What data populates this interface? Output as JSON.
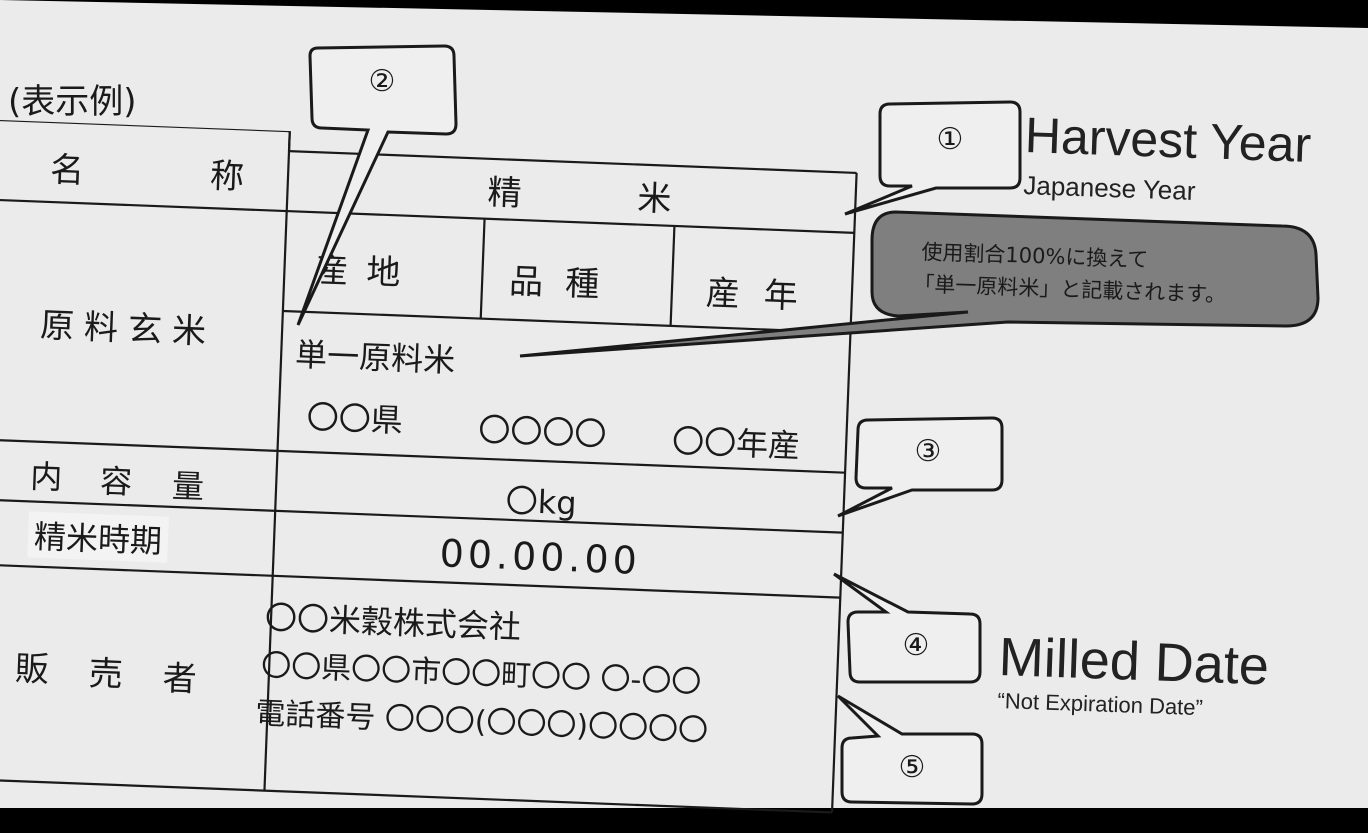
{
  "example_label": "(表示例)",
  "table": {
    "name_label": [
      "名",
      "称"
    ],
    "name_value": [
      "精",
      "米"
    ],
    "raw_label": "原料玄米",
    "sub_headers": [
      "産地",
      "品種",
      "産年"
    ],
    "single_origin": "単一原料米",
    "origin_row": [
      "〇〇県",
      "〇〇〇〇",
      "〇〇年産"
    ],
    "content_label": [
      "内",
      "容",
      "量"
    ],
    "content_value": "〇kg",
    "milled_label": "精米時期",
    "milled_value": "00.00.00",
    "seller_label": [
      "販",
      "売",
      "者"
    ],
    "seller_lines": [
      "〇〇米穀株式会社",
      "〇〇県〇〇市〇〇町〇〇 〇-〇〇",
      "電話番号 〇〇〇(〇〇〇)〇〇〇〇"
    ]
  },
  "callouts": {
    "c1": "①",
    "c2": "②",
    "c3": "③",
    "c4": "④",
    "c5": "⑤",
    "note_line1": "使用割合100%に換えて",
    "note_line2": "「単一原料米」と記載されます。"
  },
  "annotations": {
    "harvest_title": "Harvest Year",
    "harvest_sub": "Japanese Year",
    "milled_title": "Milled Date",
    "milled_sub": "“Not Expiration Date”"
  }
}
